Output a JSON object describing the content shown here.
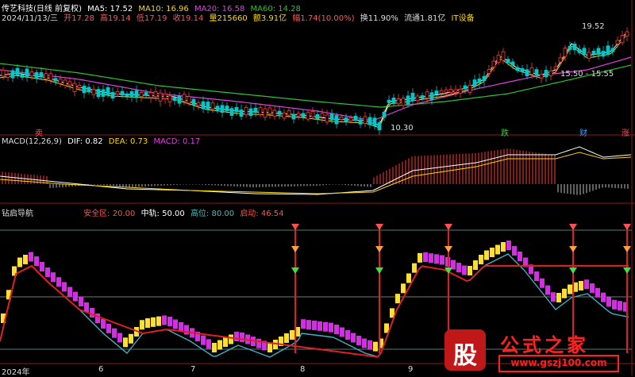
{
  "header": {
    "stock_name": "传艺科技(日线 前复权)",
    "ma5": "MA5: 17.52",
    "ma10": "MA10: 16.96",
    "ma20": "MA20: 16.58",
    "ma60": "MA60: 14.28",
    "date": "2024/11/13/三",
    "open": "开17.28",
    "high": "高19.14",
    "low": "低17.19",
    "close": "收19.14",
    "volume": "量215660",
    "amount": "额3.91亿",
    "change": "幅1.74(10.00%)",
    "turnover": "换11.90%",
    "float_cap": "流通1.81亿",
    "sector": "IT设备"
  },
  "main_chart": {
    "high_label": "19.52",
    "low_label": "10.30",
    "range_label": "15.50 - 15.55",
    "markers": [
      "卖",
      "跌",
      "财",
      "涨"
    ]
  },
  "macd": {
    "title": "MACD(12,26,9)",
    "dif": "DIF: 0.82",
    "dea": "DEA: 0.73",
    "macd": "MACD: 0.17"
  },
  "indicator": {
    "title": "钻启导航",
    "safe": "安全区: 20.00",
    "mid": "中轨: 50.00",
    "high": "高位: 80.00",
    "start": "启动: 46.54"
  },
  "time_axis": {
    "labels": [
      "2024年",
      "6",
      "7",
      "8",
      "9"
    ]
  },
  "watermark": {
    "logo": "股",
    "title": "公式之家",
    "url": "www.gszj100.com"
  },
  "colors": {
    "up": "#ff3b3b",
    "down": "#00c8c8",
    "ma5": "#ffffff",
    "ma10": "#ffd700",
    "ma20": "#e040e0",
    "ma60": "#30c030"
  }
}
